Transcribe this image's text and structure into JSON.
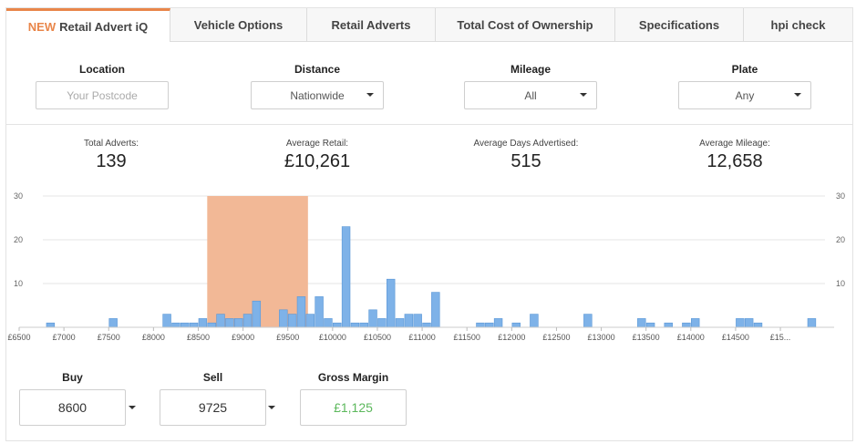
{
  "tabs": [
    {
      "new": "NEW",
      "label": "Retail Advert iQ"
    },
    {
      "label": "Vehicle Options"
    },
    {
      "label": "Retail Adverts"
    },
    {
      "label": "Total Cost of Ownership"
    },
    {
      "label": "Specifications"
    },
    {
      "label": "hpi check"
    }
  ],
  "filters": {
    "location": {
      "label": "Location",
      "placeholder": "Your Postcode"
    },
    "distance": {
      "label": "Distance",
      "value": "Nationwide"
    },
    "mileage": {
      "label": "Mileage",
      "value": "All"
    },
    "plate": {
      "label": "Plate",
      "value": "Any"
    }
  },
  "stats": {
    "total_adverts": {
      "label": "Total Adverts:",
      "value": "139"
    },
    "average_retail": {
      "label": "Average Retail:",
      "value": "£10,261"
    },
    "average_days": {
      "label": "Average Days Advertised:",
      "value": "515"
    },
    "average_mileage": {
      "label": "Average Mileage:",
      "value": "12,658"
    }
  },
  "colors": {
    "accent": "#e9864a",
    "bar": "#7eb2e8",
    "range": "#f2b896",
    "margin": "#5cb85c"
  },
  "chart_data": {
    "type": "bar",
    "x_start": 6500,
    "bin_width": 100,
    "ylim": [
      0,
      30
    ],
    "y_ticks": [
      "10",
      "20",
      "30"
    ],
    "x_tick_labels": [
      "£6500",
      "£7000",
      "£7500",
      "£8000",
      "£8500",
      "£9000",
      "£9500",
      "£10000",
      "£10500",
      "£11000",
      "£11500",
      "£12000",
      "£12500",
      "£13000",
      "£13500",
      "£14000",
      "£14500",
      "£15..."
    ],
    "highlight_range": [
      8600,
      9725
    ],
    "counts": [
      0,
      0,
      0,
      1,
      0,
      0,
      0,
      0,
      0,
      0,
      2,
      0,
      0,
      0,
      0,
      0,
      3,
      1,
      1,
      1,
      2,
      1,
      3,
      2,
      2,
      3,
      6,
      0,
      0,
      4,
      3,
      7,
      3,
      7,
      2,
      1,
      23,
      1,
      1,
      4,
      2,
      11,
      2,
      3,
      3,
      1,
      8,
      0,
      0,
      0,
      0,
      1,
      1,
      2,
      0,
      1,
      0,
      3,
      0,
      0,
      0,
      0,
      0,
      3,
      0,
      0,
      0,
      0,
      0,
      2,
      1,
      0,
      1,
      0,
      1,
      2,
      0,
      0,
      0,
      0,
      2,
      2,
      1,
      0,
      0,
      0,
      0,
      0,
      2,
      0,
      0
    ]
  },
  "bottom": {
    "buy": {
      "label": "Buy",
      "value": "8600"
    },
    "sell": {
      "label": "Sell",
      "value": "9725"
    },
    "gross_margin": {
      "label": "Gross Margin",
      "value": "£1,125"
    }
  }
}
